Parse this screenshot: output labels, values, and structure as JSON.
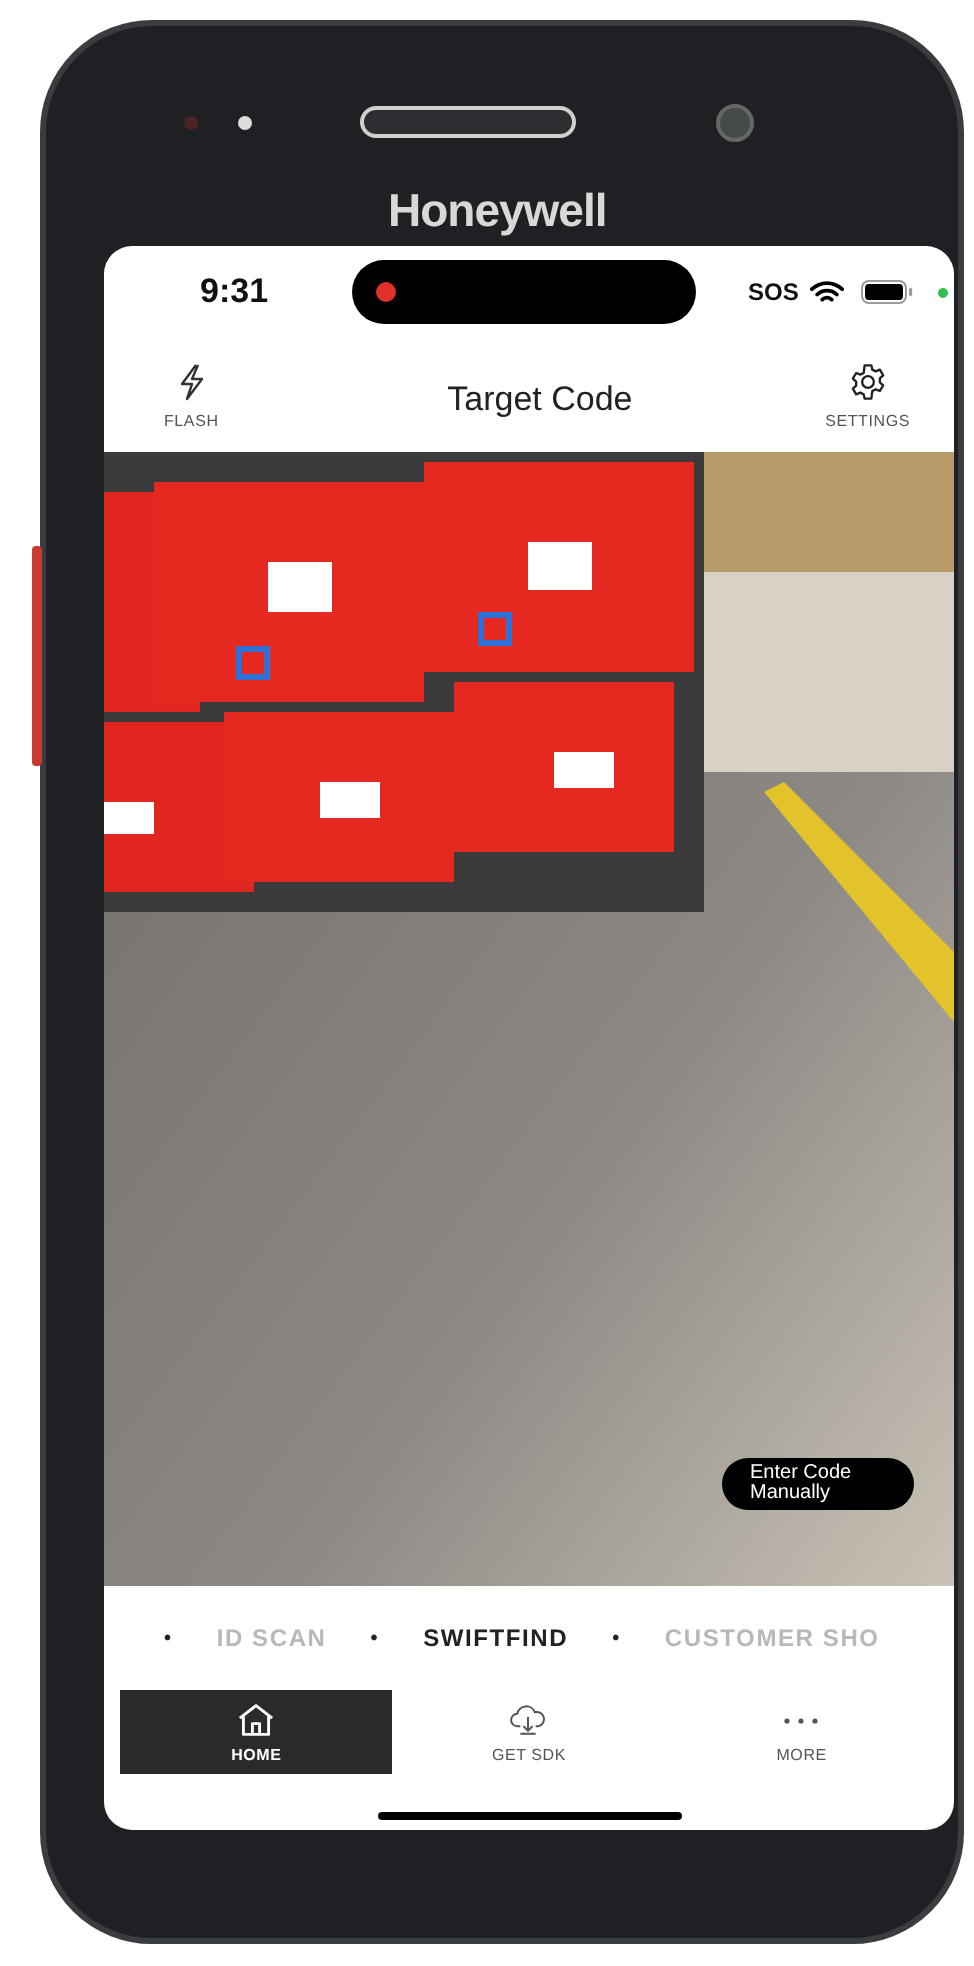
{
  "device": {
    "brand": "Honeywell"
  },
  "status_bar": {
    "time": "9:31",
    "recording": true,
    "sos": "SOS",
    "privacy_dot": true
  },
  "header": {
    "title": "Target Code",
    "left_action": {
      "label": "FLASH"
    },
    "right_action": {
      "label": "SETTINGS"
    }
  },
  "camera": {
    "button": "Enter Code Manually"
  },
  "modes": [
    {
      "kind": "dot",
      "label": "•"
    },
    {
      "kind": "mode",
      "label": "ID SCAN",
      "selected": false
    },
    {
      "kind": "dot",
      "label": "•"
    },
    {
      "kind": "mode",
      "label": "SWIFTFIND",
      "selected": true
    },
    {
      "kind": "dot",
      "label": "•"
    },
    {
      "kind": "mode",
      "label": "CUSTOMER SHO",
      "selected": false
    }
  ],
  "tab_bar": [
    {
      "kind": "home",
      "label": "HOME",
      "selected": true
    },
    {
      "kind": "download",
      "label": "GET SDK",
      "selected": false
    },
    {
      "kind": "more",
      "label": "MORE",
      "selected": false
    }
  ]
}
